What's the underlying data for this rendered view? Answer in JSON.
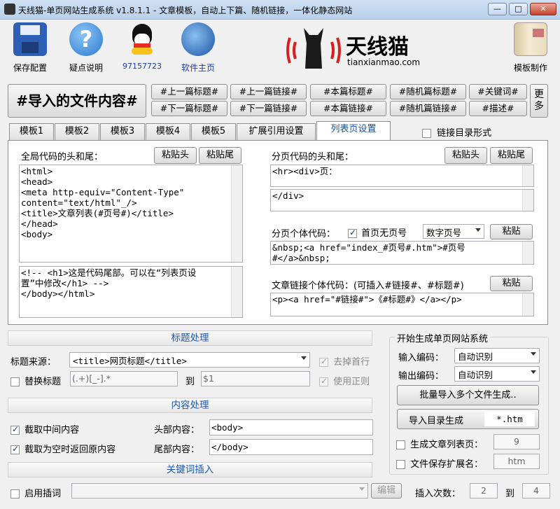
{
  "window": {
    "title": "天线猫-单页网站生成系统 v1.8.1.1 - 文章模板，自动上下篇、随机链接，一体化静态网站"
  },
  "toolbar": {
    "save": "保存配置",
    "help": "疑点说明",
    "qq": "97157723",
    "home": "软件主页",
    "template": "模板制作",
    "logo_text": "天线猫",
    "logo_url": "tianxianmao.com"
  },
  "tagbar": {
    "import_content": "#导入的文件内容#",
    "tags_row1": [
      "#上一篇标题#",
      "#上一篇链接#",
      "#本篇标题#",
      "#随机篇标题#",
      "#关键词#"
    ],
    "tags_row2": [
      "#下一篇标题#",
      "#下一篇链接#",
      "#本篇链接#",
      "#随机篇链接#",
      "#描述#"
    ],
    "more": "更多"
  },
  "tabs": [
    "模板1",
    "模板2",
    "模板3",
    "模板4",
    "模板5",
    "扩展引用设置",
    "列表页设置"
  ],
  "link_dir_label": "链接目录形式",
  "left_panel": {
    "global_label": "全局代码的头和尾：",
    "paste_head": "粘贴头",
    "paste_tail": "粘贴尾",
    "head_code": "<html>\n<head>\n<meta http-equiv=\"Content-Type\"\ncontent=\"text/html\"_/>\n<title>文章列表(#页号#)</title>\n</head>\n<body>",
    "tail_code": "<!-- <h1>这是代码尾部。可以在“列表页设\n置”中修改</h1> -->\n</body></html>"
  },
  "right_panel": {
    "page_label": "分页代码的头和尾：",
    "paste_head": "粘贴头",
    "paste_tail": "粘贴尾",
    "page_head_code": "<hr><div>页：",
    "page_tail_code": "</div>",
    "single_label": "分页个体代码：",
    "first_no_num": "首页无页号",
    "num_select": "数字页号",
    "paste": "粘贴",
    "single_code": "&nbsp;<a href=\"index_#页号#.htm\">#页号\n#</a>&nbsp;",
    "article_label": "文章链接个体代码：(可插入#链接#、#标题#)",
    "article_paste": "粘贴",
    "article_code": "<p><a href=\"#链接#\">《#标题#》</a></p>"
  },
  "title_proc": {
    "header": "标题处理",
    "source_label": "标题来源：",
    "source_value": "<title>网页标题</title>",
    "remove_first": "去掉首行",
    "replace": "替换标题",
    "replace_from": "(.+)[_-].*",
    "to": "到",
    "replace_to": "$1",
    "use_regex": "使用正则"
  },
  "content_proc": {
    "header": "内容处理",
    "cut_middle": "截取中间内容",
    "head_label": "头部内容：",
    "head_value": "<body>",
    "empty_return": "截取为空时返回原内容",
    "tail_label": "尾部内容：",
    "tail_value": "</body>"
  },
  "keyword": {
    "header": "关键词插入",
    "enable": "启用插词",
    "edit": "编辑",
    "insert_count": "插入次数：",
    "count_from": "2",
    "to": "到",
    "count_to": "4"
  },
  "generate": {
    "header": "开始生成单页网站系统",
    "input_enc": "输入编码：",
    "input_value": "自动识别",
    "output_enc": "输出编码：",
    "output_value": "自动识别",
    "batch": "批量导入多个文件生成..",
    "dir_import": "导入目录生成",
    "dir_pattern": "*.htm",
    "gen_list": "生成文章列表页：",
    "list_value": "9",
    "ext_label": "文件保存扩展名：",
    "ext_value": "htm"
  }
}
